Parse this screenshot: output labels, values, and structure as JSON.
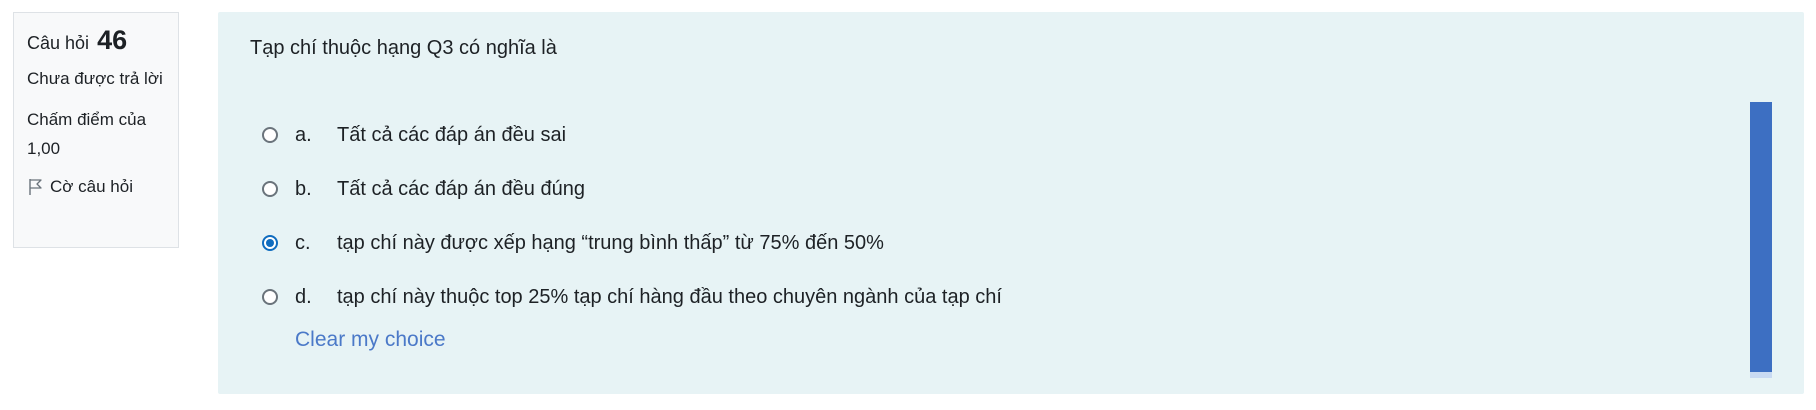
{
  "info": {
    "question_label": "Câu hỏi",
    "question_number": "46",
    "state": "Chưa được trả lời",
    "grade": "Chấm điểm của 1,00",
    "flag_label": "Cờ câu hỏi"
  },
  "question": {
    "text": "Tạp chí thuộc hạng Q3 có nghĩa là",
    "answers": [
      {
        "letter": "a.",
        "text": "Tất cả các đáp án đều sai",
        "selected": false
      },
      {
        "letter": "b.",
        "text": "Tất cả các đáp án đều đúng",
        "selected": false
      },
      {
        "letter": "c.",
        "text": "tạp chí này được xếp hạng “trung bình thấp” từ 75% đến 50%",
        "selected": true
      },
      {
        "letter": "d.",
        "text": "tạp chí này thuộc top 25% tạp chí hàng đầu theo chuyên ngành của tạp chí",
        "selected": false
      }
    ],
    "clear_label": "Clear my choice"
  },
  "colors": {
    "question_bg": "#e7f3f5",
    "info_bg": "#f8f9fa",
    "link": "#4b79c8",
    "radio_selected": "#0f6cbf",
    "scrollbar": "#3d6fc2"
  }
}
